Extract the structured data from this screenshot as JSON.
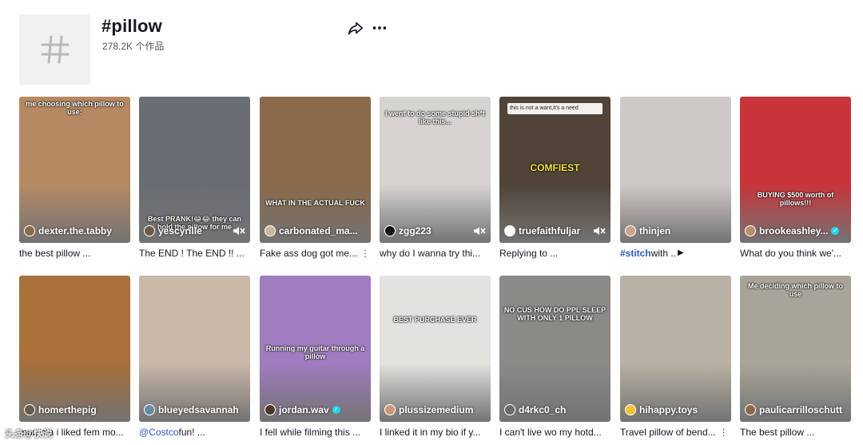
{
  "header": {
    "title": "#pillow",
    "subtitle": "278.2K 个作品",
    "icon": "hashtag-icon"
  },
  "videos": [
    {
      "author": "dexter.the.tabby",
      "desc": "the best pillow ...",
      "overlay": "me choosing which pillow to use:",
      "bg": "#b58a63",
      "av": "#8a6a4a",
      "muted": false
    },
    {
      "author": "yescyrille",
      "desc": "The END ! The END !! ...",
      "overlay": "Best PRANK!😂😂 they can hold the pillow for me",
      "bg": "#6a6e74",
      "av": "#6a5a4a",
      "muted": true
    },
    {
      "author": "carbonated_ma...",
      "desc": "Fake ass dog got me...",
      "overlay": "WHAT IN THE ACTUAL FUCK",
      "bg": "#8a6a4a",
      "av": "#c8b89a",
      "muted": false,
      "kebab": "⋮"
    },
    {
      "author": "zgg223",
      "desc": "why do I wanna try thi...",
      "overlay": "I went to do some stupid sh*t like this...",
      "bg": "#d7d4d0",
      "av": "#111111",
      "muted": true
    },
    {
      "author": "truefaithfuljar",
      "desc": "Replying to ...",
      "overlay": "COMFIEST",
      "caption": "this is not a want,it's a need",
      "bg": "#504438",
      "av": "#ffffff",
      "muted": true
    },
    {
      "author": "thinjen",
      "desc_hashtag": "#stitch",
      "desc_rest": " with ..",
      "bg": "#cfc9c6",
      "av": "#c9a48a",
      "muted": false,
      "play": "▶"
    },
    {
      "author": "brookeashley...",
      "desc": "What do you think we'...",
      "overlay": "BUYING $500 worth of pillows!!!",
      "bg": "#c9343b",
      "av": "#b6906e",
      "muted": false,
      "verified": true
    },
    {
      "author": "homerthepig",
      "desc": "momma i liked fem mo...",
      "bg": "#a8703a",
      "av": "#6a5a4a",
      "muted": false
    },
    {
      "author": "blueyedsavannah",
      "desc_mention": "@Costco",
      "desc_rest": " fun! ...",
      "bg": "#c9b7a8",
      "av": "#6a8aa0",
      "muted": false
    },
    {
      "author": "jordan.wav",
      "desc": "I fell while filming this ...",
      "overlay": "Running my guitar through a pillow",
      "bg": "#a07cc0",
      "av": "#4a3a2a",
      "muted": false,
      "verified": true
    },
    {
      "author": "plussizemedium",
      "desc": "I linked it in my bio if y...",
      "overlay": "BEST PURCHASE EVER",
      "bg": "#e4e2df",
      "av": "#c99a7a",
      "muted": false
    },
    {
      "author": "d4rkc0_ch",
      "desc": "I can't live wo my hotd...",
      "overlay": "NO CUS HOW DO PPL SLEEP WITH ONLY 1 PILLOW",
      "bg": "#8c8a86",
      "av": "#6a6a6a",
      "muted": false
    },
    {
      "author": "hihappy.toys",
      "desc": "Travel pillow of bend...",
      "bg": "#b9b2a4",
      "av": "#f2c230",
      "muted": false,
      "kebab": "⋮"
    },
    {
      "author": "paulicarrilloschutt",
      "desc": "The best pillow ...",
      "overlay": "Me deciding which pillow to use",
      "bg": "#a9a49a",
      "av": "#8a6a4a",
      "muted": false
    }
  ],
  "watermark": "头条@快说",
  "colors": {
    "accent": "#2b5db9",
    "verified": "#20d5ec",
    "text": "#161823"
  }
}
